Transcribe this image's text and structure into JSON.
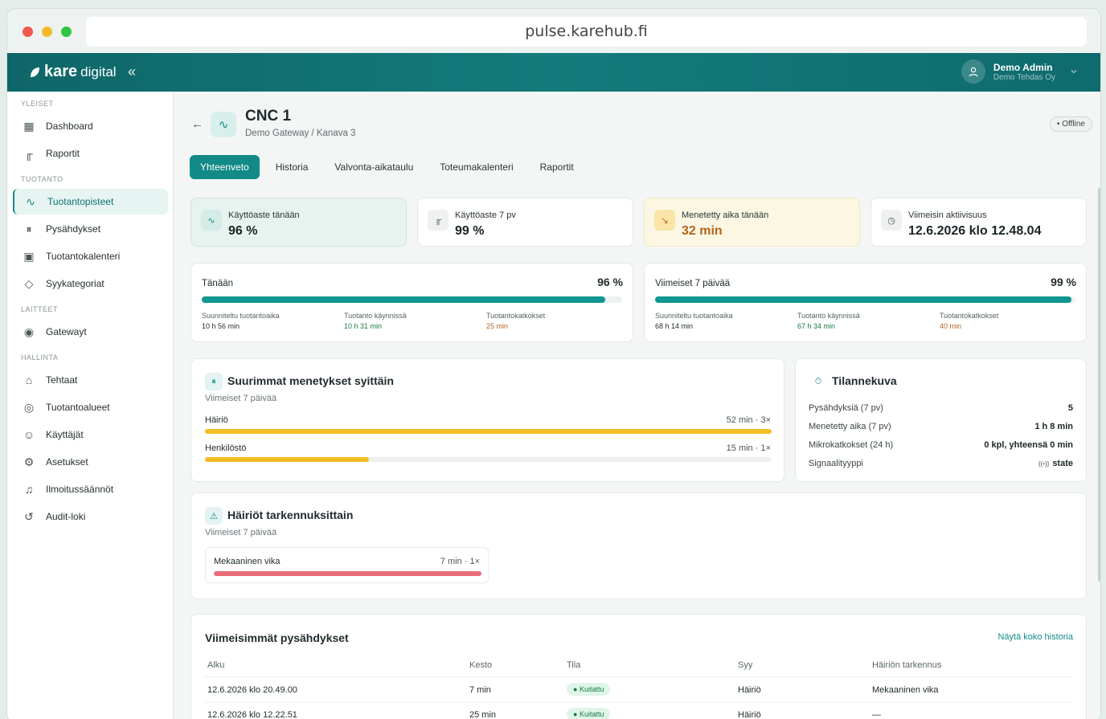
{
  "browser": {
    "url": "pulse.karehub.fi"
  },
  "app": {
    "logo_main": "kare",
    "logo_sub": "digital",
    "collapse_icon": "«",
    "user": {
      "name": "Demo Admin",
      "org": "Demo Tehdas Oy"
    }
  },
  "sidebar": {
    "sections": [
      {
        "title": "YLEISET",
        "items": [
          {
            "label": "Dashboard",
            "icon": "grid-icon"
          },
          {
            "label": "Raportit",
            "icon": "bar-chart-icon"
          }
        ]
      },
      {
        "title": "TUOTANTO",
        "items": [
          {
            "label": "Tuotantopisteet",
            "icon": "pulse-icon",
            "active": true
          },
          {
            "label": "Pysähdykset",
            "icon": "pause-icon"
          },
          {
            "label": "Tuotantokalenteri",
            "icon": "calendar-icon"
          },
          {
            "label": "Syykategoriat",
            "icon": "tag-icon"
          }
        ]
      },
      {
        "title": "LAITTEET",
        "items": [
          {
            "label": "Gatewayt",
            "icon": "signal-icon"
          }
        ]
      },
      {
        "title": "HALLINTA",
        "items": [
          {
            "label": "Tehtaat",
            "icon": "factory-icon"
          },
          {
            "label": "Tuotantoalueet",
            "icon": "location-icon"
          },
          {
            "label": "Käyttäjät",
            "icon": "users-icon"
          },
          {
            "label": "Asetukset",
            "icon": "gear-icon"
          },
          {
            "label": "Ilmoitussäännöt",
            "icon": "bell-icon"
          },
          {
            "label": "Audit-loki",
            "icon": "history-icon"
          }
        ]
      }
    ]
  },
  "page": {
    "title": "CNC 1",
    "subtitle": "Demo Gateway / Kanava 3",
    "status": "Offline",
    "tabs": [
      "Yhteenveto",
      "Historia",
      "Valvonta-aikataulu",
      "Toteumakalenteri",
      "Raportit"
    ]
  },
  "kpis": [
    {
      "label": "Käyttöaste tänään",
      "value": "96 %",
      "icon": "pulse-icon",
      "tone": "teal"
    },
    {
      "label": "Käyttöaste 7 pv",
      "value": "99 %",
      "icon": "bar-chart-icon",
      "tone": "plain"
    },
    {
      "label": "Menetetty aika tänään",
      "value": "32 min",
      "icon": "trend-down-icon",
      "tone": "warn"
    },
    {
      "label": "Viimeisin aktiivisuus",
      "value": "12.6.2026 klo 12.48.04",
      "icon": "clock-icon",
      "tone": "plain"
    }
  ],
  "progress": [
    {
      "label": "Tänään",
      "value": "96 %",
      "fraction": 0.96,
      "stats": [
        {
          "label": "Suunniteltu tuotantoaika",
          "value": "10 h 56 min"
        },
        {
          "label": "Tuotanto käynnissä",
          "value": "10 h 31 min"
        },
        {
          "label": "Tuotantokatkokset",
          "value": "25 min"
        }
      ]
    },
    {
      "label": "Viimeiset 7 päivää",
      "value": "99 %",
      "fraction": 0.99,
      "stats": [
        {
          "label": "Suunniteltu tuotantoaika",
          "value": "68 h 14 min"
        },
        {
          "label": "Tuotanto käynnissä",
          "value": "67 h 34 min"
        },
        {
          "label": "Tuotantokatkokset",
          "value": "40 min"
        }
      ]
    }
  ],
  "losses": {
    "title": "Suurimmat menetykset syittäin",
    "subtitle": "Viimeiset 7 päivää",
    "items": [
      {
        "label": "Häiriö",
        "value": "52 min · 3×",
        "fraction": 1.0
      },
      {
        "label": "Henkilöstö",
        "value": "15 min · 1×",
        "fraction": 0.29
      }
    ]
  },
  "snapshot": {
    "title": "Tilannekuva",
    "rows": [
      {
        "label": "Pysähdyksiä (7 pv)",
        "value": "5"
      },
      {
        "label": "Menetetty aika (7 pv)",
        "value": "1 h 8 min"
      },
      {
        "label": "Mikrokatkokset (24 h)",
        "value": "0 kpl, yhteensä 0 min"
      },
      {
        "label": "Signaalityyppi",
        "value": "state"
      }
    ]
  },
  "faults": {
    "title": "Häiriöt tarkennuksittain",
    "subtitle": "Viimeiset 7 päivää",
    "items": [
      {
        "label": "Mekaaninen vika",
        "value": "7 min · 1×",
        "fraction": 1.0
      }
    ]
  },
  "recent": {
    "title": "Viimeisimmät pysähdykset",
    "link": "Näytä koko historia",
    "columns": [
      "Alku",
      "Kesto",
      "Tila",
      "Syy",
      "Häiriön tarkennus"
    ],
    "rows": [
      [
        "12.6.2026 klo 20.49.00",
        "7 min",
        "Kuitattu",
        "Häiriö",
        "Mekaaninen vika"
      ],
      [
        "12.6.2026 klo 12.22.51",
        "25 min",
        "Kuitattu",
        "Häiriö",
        "—"
      ]
    ]
  },
  "colors": {
    "accent": "#118a88",
    "warn": "#b5651d",
    "bar_yellow": "#f5bd24",
    "bar_red": "#ec6b7a",
    "ok": "#177a44"
  }
}
